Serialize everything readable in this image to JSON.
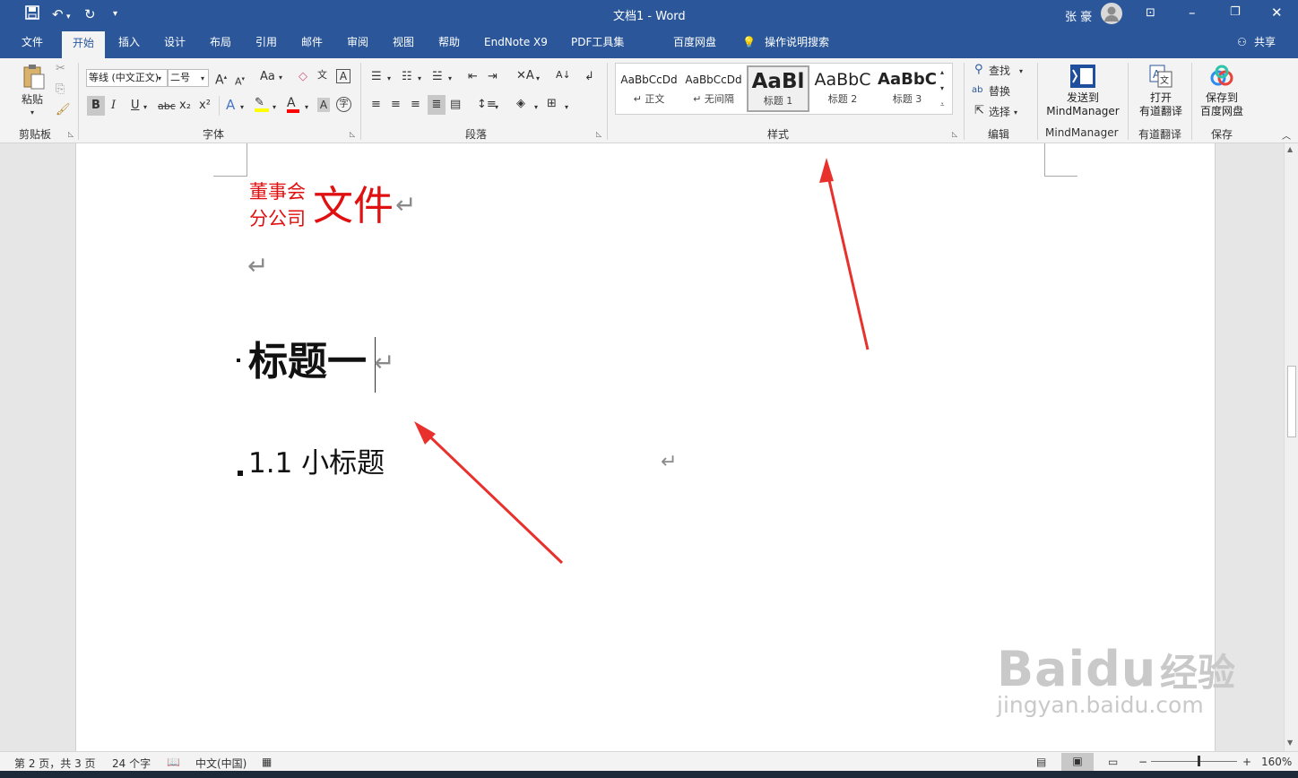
{
  "titlebar": {
    "doc_title": "文档1 - Word",
    "user": "张 豪",
    "qat": {
      "save_icon": "save-icon",
      "undo_icon": "undo-icon",
      "redo_icon": "redo-icon",
      "customize_icon": "customize-icon"
    }
  },
  "tabs": [
    "文件",
    "开始",
    "插入",
    "设计",
    "布局",
    "引用",
    "邮件",
    "审阅",
    "视图",
    "帮助",
    "EndNote X9",
    "PDF工具集",
    "百度网盘"
  ],
  "tell_me": "操作说明搜索",
  "share": "共享",
  "ribbon": {
    "clipboard": {
      "label": "剪贴板",
      "paste": "粘贴"
    },
    "font": {
      "label": "字体",
      "font_name": "等线 (中文正文)",
      "font_size": "二号",
      "bold": "B",
      "italic": "I",
      "underline": "U",
      "strikethrough": "abc",
      "subscript": "x₂",
      "superscript": "x²",
      "grow": "A",
      "shrink": "A",
      "case": "Aa",
      "highlight_color": "#ffff00",
      "font_color": "#ff0000"
    },
    "paragraph": {
      "label": "段落"
    },
    "styles": {
      "label": "样式",
      "items": [
        {
          "preview": "AaBbCcDd",
          "name": "↵ 正文"
        },
        {
          "preview": "AaBbCcDd",
          "name": "↵ 无间隔"
        },
        {
          "preview": "AaBl",
          "name": "标题 1"
        },
        {
          "preview": "AaBbC",
          "name": "标题 2"
        },
        {
          "preview": "AaBbC",
          "name": "标题 3"
        }
      ]
    },
    "editing": {
      "label": "编辑",
      "find": "查找",
      "replace": "替换",
      "select": "选择"
    },
    "mindmanager": {
      "label": "MindManager",
      "button": "发送到\nMindManager",
      "button_line1": "发送到",
      "button_line2": "MindManager"
    },
    "youdao": {
      "label": "有道翻译",
      "button_line1": "打开",
      "button_line2": "有道翻译"
    },
    "baidu": {
      "label": "保存",
      "button_line1": "保存到",
      "button_line2": "百度网盘"
    }
  },
  "document": {
    "header_small_line1": "董事会",
    "header_small_line2": "分公司",
    "header_big": "文件",
    "heading1": "标题一",
    "heading2": "1.1 小标题",
    "para_mark": "↵",
    "accent_red": "#e01010"
  },
  "statusbar": {
    "page": "第 2 页，共 3 页",
    "words": "24 个字",
    "language": "中文(中国)",
    "zoom": "160%"
  },
  "watermark": {
    "brand": "Baidu",
    "brand_cn": "经验",
    "url": "jingyan.baidu.com"
  }
}
